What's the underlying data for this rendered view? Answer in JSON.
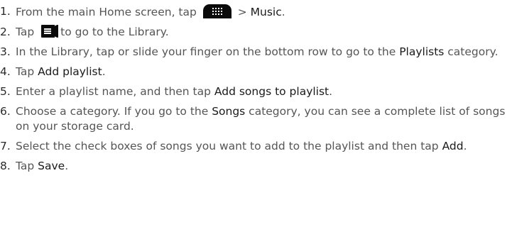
{
  "steps": [
    {
      "num": "1.",
      "parts": [
        "From the main Home screen, tap",
        "> ",
        "Music",
        "."
      ],
      "icon": "app-launcher-icon"
    },
    {
      "num": "2.",
      "parts": [
        "Tap",
        "to go to the Library."
      ],
      "icon": "library-icon"
    },
    {
      "num": "3.",
      "parts": [
        "In the Library, tap or slide your finger on the bottom row to go to the ",
        "Playlists",
        " category."
      ]
    },
    {
      "num": "4.",
      "parts": [
        "Tap ",
        "Add playlist",
        "."
      ]
    },
    {
      "num": "5.",
      "parts": [
        "Enter a playlist name, and then tap ",
        "Add songs to playlist",
        "."
      ]
    },
    {
      "num": "6.",
      "parts": [
        "Choose a category. If you go to the ",
        "Songs",
        " category, you can see a complete list of songs on your storage card."
      ]
    },
    {
      "num": "7.",
      "parts": [
        "Select the check boxes of songs you want to add to the playlist and then tap ",
        "Add",
        "."
      ]
    },
    {
      "num": "8.",
      "parts": [
        "Tap ",
        "Save",
        "."
      ]
    }
  ],
  "colors": {
    "body_text": "#555555",
    "highlight_text": "#1a1a1a",
    "icon_bg": "#0a0a0a"
  }
}
